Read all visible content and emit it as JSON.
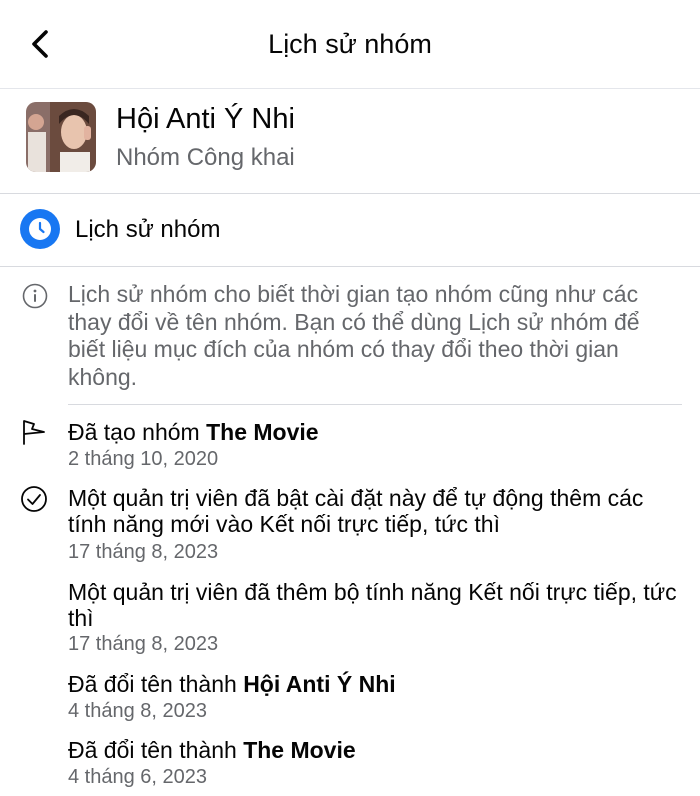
{
  "header": {
    "title": "Lịch sử nhóm"
  },
  "group": {
    "name": "Hội Anti Ý Nhi",
    "type": "Nhóm Công khai"
  },
  "section": {
    "label": "Lịch sử nhóm"
  },
  "info": {
    "text": "Lịch sử nhóm cho biết thời gian tạo nhóm cũng như các thay đổi về tên nhóm. Bạn có thể dùng Lịch sử nhóm để biết liệu mục đích của nhóm có thay đổi theo thời gian không."
  },
  "history": [
    {
      "icon": "flag-icon",
      "text": "Đã tạo nhóm ",
      "bold": "The Movie",
      "date": "2 tháng 10, 2020"
    },
    {
      "icon": "check-circle-icon",
      "text": "Một quản trị viên đã bật cài đặt này để tự động thêm các tính năng mới vào Kết nối trực tiếp, tức thì",
      "bold": "",
      "date": "17 tháng 8, 2023"
    },
    {
      "icon": "",
      "text": "Một quản trị viên đã thêm bộ tính năng Kết nối trực tiếp, tức thì",
      "bold": "",
      "date": "17 tháng 8, 2023"
    },
    {
      "icon": "",
      "text": "Đã đổi tên thành ",
      "bold": "Hội Anti Ý Nhi",
      "date": "4 tháng 8, 2023"
    },
    {
      "icon": "",
      "text": "Đã đổi tên thành ",
      "bold": "The Movie",
      "date": "4 tháng 6, 2023"
    }
  ],
  "colors": {
    "accent": "#1877f2",
    "secondary_text": "#65676b",
    "divider": "#d8dadf"
  }
}
